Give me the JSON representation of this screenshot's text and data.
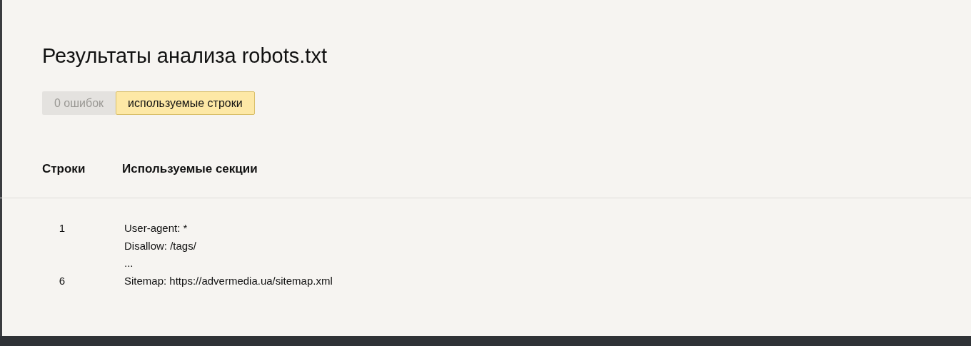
{
  "title": "Результаты анализа robots.txt",
  "tabs": [
    {
      "label": "0 ошибок",
      "selected": false
    },
    {
      "label": "используемые строки",
      "selected": true
    }
  ],
  "table": {
    "columns": [
      "Строки",
      "Используемые секции"
    ],
    "rows": [
      {
        "line": "1",
        "text": "User-agent: *"
      },
      {
        "text": "Disallow: /tags/"
      },
      {
        "text": "..."
      },
      {
        "line": "6",
        "text": "Sitemap: https://advermedia.ua/sitemap.xml"
      }
    ]
  }
}
